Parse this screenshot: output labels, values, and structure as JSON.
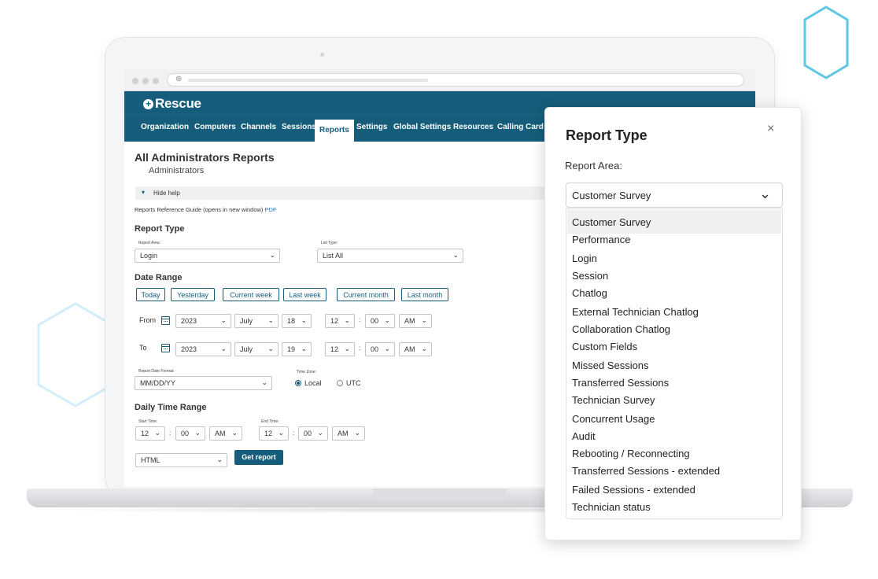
{
  "brand": {
    "logo_text": "Rescue"
  },
  "nav": {
    "items": [
      "Organization",
      "Computers",
      "Channels",
      "Sessions",
      "Reports",
      "Settings",
      "Global Settings",
      "Resources",
      "Calling Card"
    ],
    "active": "Reports"
  },
  "page": {
    "title": "All Administrators Reports",
    "subtitle": "Administrators",
    "help_toggle": "Hide help",
    "help_link_text": "Reports Reference Guide (opens in new window)",
    "help_link_pdf": "PDF"
  },
  "report_type": {
    "heading": "Report Type",
    "area_label": "Report Area:",
    "area_value": "Login",
    "list_label": "List Type:",
    "list_value": "List All"
  },
  "date_range": {
    "heading": "Date Range",
    "quick_buttons": [
      "Today",
      "Yesterday",
      "Current week",
      "Last week",
      "Current month",
      "Last month"
    ],
    "from": {
      "label": "From",
      "year": "2023",
      "month": "July",
      "day": "18",
      "hour": "12",
      "minute": "00",
      "ampm": "AM"
    },
    "to": {
      "label": "To",
      "year": "2023",
      "month": "July",
      "day": "19",
      "hour": "12",
      "minute": "00",
      "ampm": "AM"
    },
    "colon": ":"
  },
  "format": {
    "date_format_label": "Report Date Format:",
    "date_format_value": "MM/DD/YY",
    "timezone_label": "Time Zone:",
    "tz_local": "Local",
    "tz_utc": "UTC"
  },
  "daily_time": {
    "heading": "Daily Time Range",
    "start_label": "Start Time:",
    "end_label": "End Time:",
    "start": {
      "hour": "12",
      "minute": "00",
      "ampm": "AM"
    },
    "end": {
      "hour": "12",
      "minute": "00",
      "ampm": "AM"
    }
  },
  "output": {
    "format_value": "HTML",
    "get_report": "Get report"
  },
  "panel": {
    "title": "Report Type",
    "close": "×",
    "area_label": "Report Area:",
    "selected": "Customer Survey",
    "options": [
      "Customer Survey",
      "Performance",
      "Login",
      "Session",
      "Chatlog",
      "External Technician Chatlog",
      "Collaboration Chatlog",
      "Custom Fields",
      "Missed Sessions",
      "Transferred Sessions",
      "Technician Survey",
      "Concurrent Usage",
      "Audit",
      "Rebooting / Reconnecting",
      "Transferred Sessions - extended",
      "Failed Sessions - extended",
      "Technician status"
    ]
  },
  "colors": {
    "brand": "#155d7a",
    "hex_accent": "#5fc6e3"
  }
}
